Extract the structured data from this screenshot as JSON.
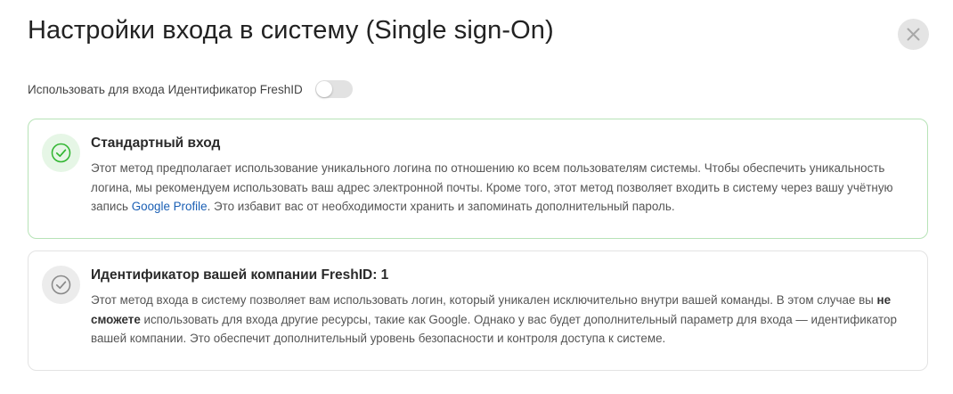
{
  "dialog": {
    "title": "Настройки входа в систему (Single sign-On)",
    "close_icon": "close-icon"
  },
  "freshid_toggle": {
    "label": "Использовать для входа Идентификатор FreshID",
    "enabled": false
  },
  "options": [
    {
      "title": "Стандартный вход",
      "selected": true,
      "icon": "check-circle-icon",
      "status_color": "#2fb52f",
      "desc_part1": "Этот метод предполагает использование уникального логина по отношению ко всем пользователям системы. Чтобы обеспечить уникальность логина, мы рекомендуем использовать ваш адрес электронной почты. Кроме того, этот метод позволяет входить в систему через вашу учётную запись ",
      "link_text": "Google Profile",
      "desc_part2": ".  Это избавит вас от необходимости хранить и запоминать дополнительный пароль."
    },
    {
      "title": "Идентификатор вашей компании FreshID: 1",
      "selected": false,
      "icon": "check-circle-icon",
      "status_color": "#888888",
      "desc_part1": "Этот метод входа в систему позволяет вам использовать логин, который уникален исключительно внутри вашей команды. В этом случае вы ",
      "desc_bold": "не сможете",
      "desc_part2": " использовать для входа другие ресурсы, такие как Google. Однако у вас будет дополнительный параметр для входа — идентификатор вашей компании. Это обеспечит дополнительный уровень безопасности и контроля доступа к системе."
    }
  ],
  "colors": {
    "link": "#1a5fb4",
    "selected_border": "#b7e3b7",
    "unselected_border": "#e3e3e3"
  }
}
